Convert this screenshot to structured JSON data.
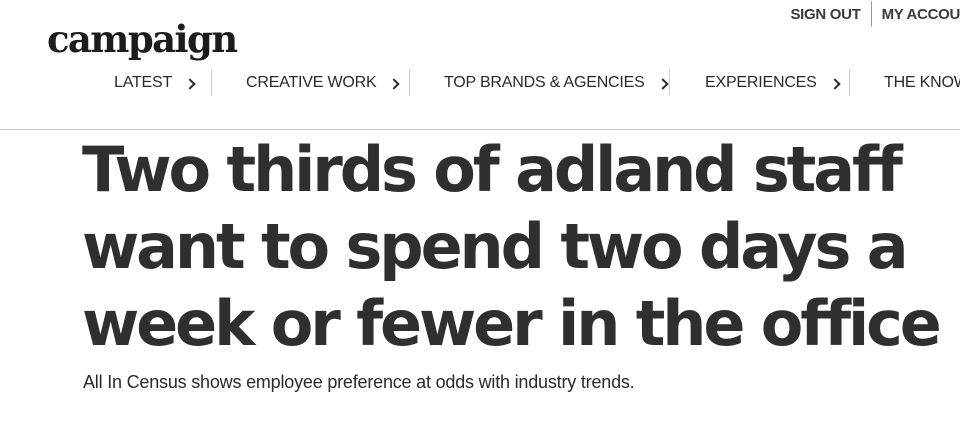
{
  "header": {
    "logo_text": "campaign",
    "account_links": {
      "sign_out": "SIGN OUT",
      "my_account": "MY ACCOU"
    }
  },
  "nav": {
    "items": [
      {
        "label": "LATEST"
      },
      {
        "label": "CREATIVE WORK"
      },
      {
        "label": "TOP BRANDS & AGENCIES"
      },
      {
        "label": "EXPERIENCES"
      },
      {
        "label": "THE KNOW"
      }
    ]
  },
  "article": {
    "headline": "Two thirds of adland staff want to spend two days a week or fewer in the office",
    "standfirst": "All In Census shows employee preference at odds with industry trends."
  },
  "colors": {
    "text": "#2f2f2f",
    "divider": "#c8c8c8"
  }
}
